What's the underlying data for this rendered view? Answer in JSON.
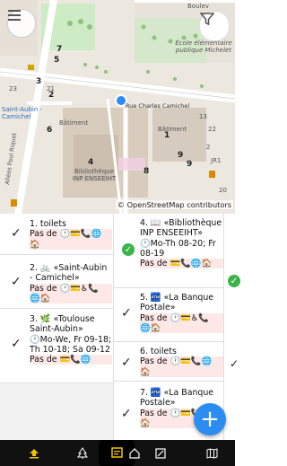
{
  "map": {
    "attribution": "© OpenStreetMap contributors",
    "labels": {
      "street_main": "Rue Charles Camichel",
      "school": "École élémentaire publique Michelet",
      "saint_aubin": "Saint-Aubin - Camichel",
      "batiment_left": "Bâtiment",
      "batiment_right": "Bâtiment",
      "biblio": "Bibliothèque INP ENSEEIHT",
      "street_bouletin": "Boulev",
      "street_riquet": "Allées Paul Riquet",
      "num_a": "23",
      "num_b": "21",
      "num_c": "22",
      "num_d": "13",
      "num_e": "2",
      "num_f": "JR1",
      "num_g": "20"
    },
    "pins": [
      "7",
      "5",
      "2",
      "3",
      "6",
      "1",
      "4",
      "8",
      "9",
      "9"
    ],
    "icons": [
      "menu-icon",
      "filter-icon",
      "current-location-icon"
    ]
  },
  "cards": [
    {
      "title": "1. toilets",
      "line1": "Pas de 🕐💳📞🌐",
      "line2": "🏠",
      "check": "✓"
    },
    {
      "title": "2. 🚲 «Saint-Aubin - Camichel»",
      "line1": "Pas de 🕐💳♿📞",
      "line2": "🌐🏠",
      "check": "✓"
    },
    {
      "title": "3. 🌿 «Toulouse Saint-Aubin»",
      "line1": "🕐Mo-We, Fr 09-18; Th 10-18; Sa 09-12",
      "line2": "Pas de 💳📞🌐",
      "check": "✓"
    },
    {
      "title": "4. 📖 «Bibliothèque INP ENSEEIHT»",
      "line1": "🕐Mo-Th 08-20; Fr 08-19",
      "line2": "Pas de 💳📞🌐🏠",
      "check": "✓"
    },
    {
      "title": "5. 🏧 «La Banque Postale»",
      "line1": "Pas de 🕐💳♿📞",
      "line2": "🌐🏠",
      "check": "✓"
    },
    {
      "title": "6. toilets",
      "line1": "Pas de 🕐💳📞🌐",
      "line2": "🏠",
      "check": "✓"
    },
    {
      "title": "7. 🏧 «La Banque Postale»",
      "line1": "Pas de 🕐💳📞🌐",
      "line2": "🏠",
      "check": "✓"
    }
  ],
  "add_label": "+",
  "navbar": {
    "items": [
      "upload",
      "tree",
      "note",
      "home",
      "edit",
      "map"
    ],
    "active": "note"
  }
}
